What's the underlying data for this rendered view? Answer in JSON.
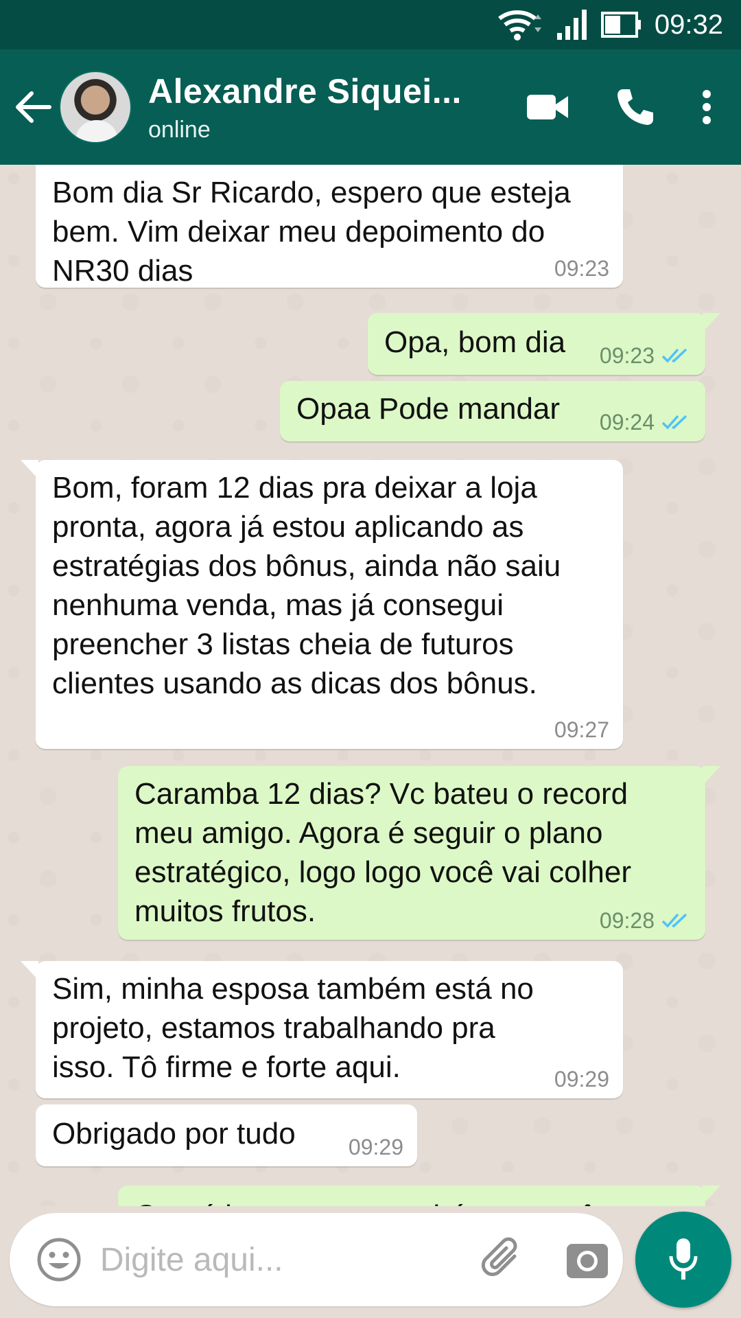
{
  "status_bar": {
    "time": "09:32"
  },
  "header": {
    "contact_name": "Alexandre Siquei...",
    "contact_status": "online"
  },
  "messages": [
    {
      "direction": "in",
      "text": "Bom dia Sr Ricardo, espero que esteja\nbem. Vim deixar meu depoimento do\nNR30 dias",
      "time": "09:23"
    },
    {
      "direction": "out",
      "text": "Opa, bom dia",
      "time": "09:23",
      "read": true
    },
    {
      "direction": "out",
      "text": "Opaa Pode mandar",
      "time": "09:24",
      "read": true
    },
    {
      "direction": "in",
      "text": "Bom, foram 12 dias pra deixar a loja\npronta, agora já estou aplicando as\nestratégias dos bônus, ainda não saiu\nnenhuma venda, mas já consegui\npreencher 3 listas cheia de futuros\nclientes usando as dicas dos bônus.",
      "time": "09:27"
    },
    {
      "direction": "out",
      "text": "Caramba 12 dias? Vc bateu o record\nmeu amigo. Agora é seguir o plano\nestratégico, logo logo você vai colher\nmuitos frutos.",
      "time": "09:28",
      "read": true
    },
    {
      "direction": "in",
      "text": "Sim, minha esposa também está no\nprojeto, estamos trabalhando pra\nisso. Tô firme e forte aqui.",
      "time": "09:29"
    },
    {
      "direction": "in",
      "text": "Obrigado por tudo",
      "time": "09:29"
    },
    {
      "direction": "out",
      "text": "Que ótimo, meus parabéns a vocês",
      "time": "",
      "read": true
    }
  ],
  "input": {
    "placeholder": "Digite aqui..."
  },
  "colors": {
    "header": "#075e54",
    "status_bar": "#054d44",
    "incoming_bubble": "#ffffff",
    "outgoing_bubble": "#dcf8c6",
    "read_ticks": "#4fc3f7",
    "mic_button": "#00897b"
  }
}
